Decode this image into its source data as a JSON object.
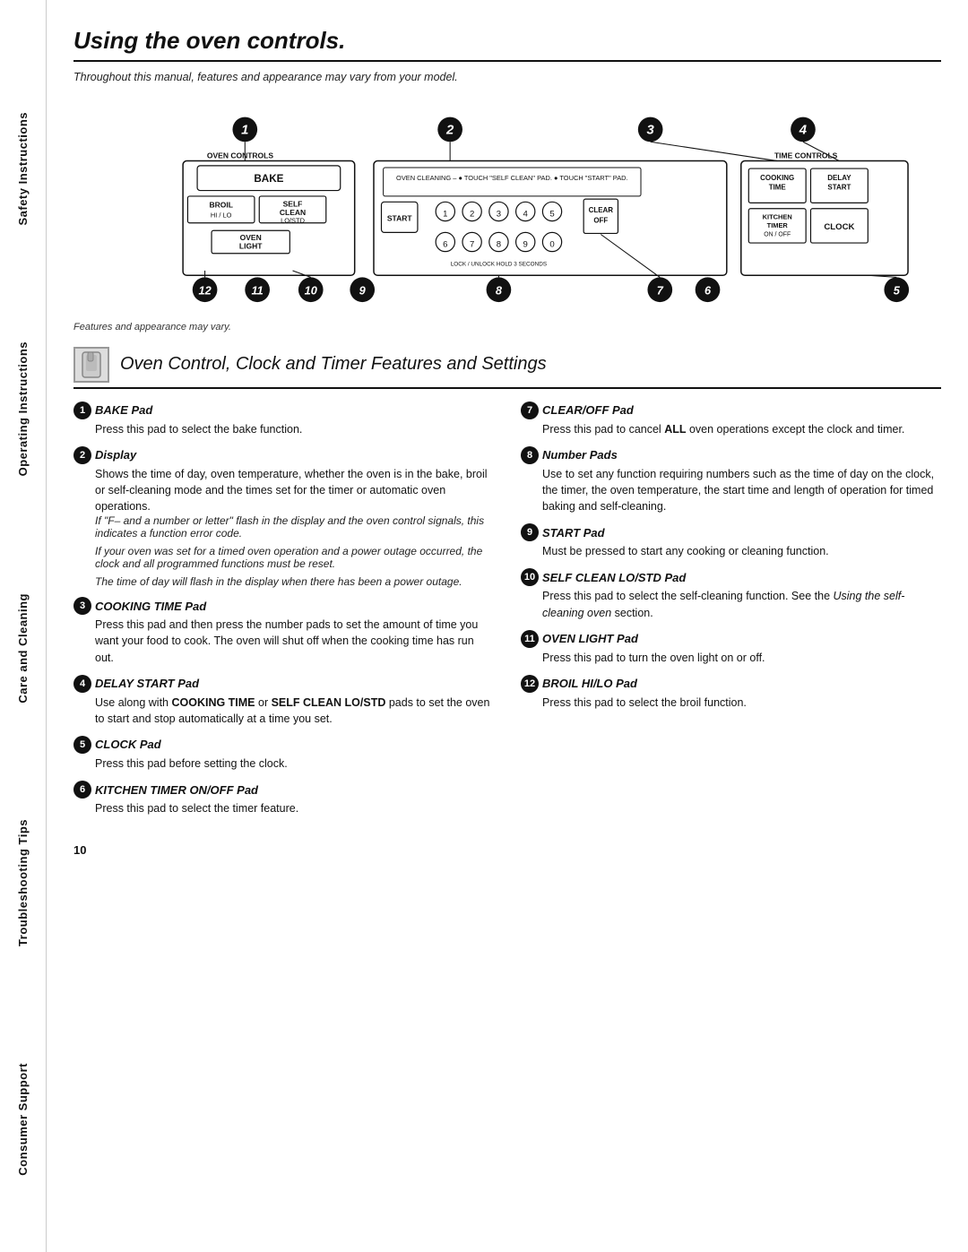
{
  "sidebar": {
    "items": [
      {
        "label": "Safety Instructions"
      },
      {
        "label": "Operating Instructions"
      },
      {
        "label": "Care and Cleaning"
      },
      {
        "label": "Troubleshooting Tips"
      },
      {
        "label": "Consumer Support"
      }
    ]
  },
  "page": {
    "title": "Using the oven controls.",
    "subtitle": "Throughout this manual, features and appearance may vary from your model.",
    "diagram_caption": "Features and appearance may vary.",
    "section_title": "Oven Control, Clock and Timer Features and Settings",
    "page_number": "10"
  },
  "features_left": [
    {
      "num": "1",
      "title": "BAKE Pad",
      "body": "Press this pad to select the bake function."
    },
    {
      "num": "2",
      "title": "Display",
      "body": "Shows the time of day, oven temperature, whether the oven is in the bake, broil or self-cleaning mode and the times set for the timer or automatic oven operations.",
      "notes": [
        "If \"F– and a number or letter\" flash in the display and the oven control signals, this indicates a function error code.",
        "If your oven was set for a timed oven operation and a power outage occurred, the clock and all programmed functions must be reset.",
        "The time of day will flash in the display when there has been a power outage."
      ]
    },
    {
      "num": "3",
      "title": "COOKING TIME Pad",
      "body": "Press this pad and then press the number pads to set the amount of time you want your food to cook. The oven will shut off when the cooking time has run out."
    },
    {
      "num": "4",
      "title": "DELAY START Pad",
      "body": "Use along with COOKING TIME or SELF CLEAN LO/STD pads to set the oven to start and stop automatically at a time you set.",
      "bold_parts": [
        "COOKING TIME",
        "SELF CLEAN LO/STD"
      ]
    },
    {
      "num": "5",
      "title": "CLOCK Pad",
      "body": "Press this pad before setting the clock."
    },
    {
      "num": "6",
      "title": "KITCHEN TIMER ON/OFF Pad",
      "body": "Press this pad to select the timer feature."
    }
  ],
  "features_right": [
    {
      "num": "7",
      "title": "CLEAR/OFF Pad",
      "body": "Press this pad to cancel ALL oven operations except the clock and timer.",
      "bold_parts": [
        "ALL"
      ]
    },
    {
      "num": "8",
      "title": "Number Pads",
      "body": "Use to set any function requiring numbers such as the time of day on the clock, the timer, the oven temperature, the start time and length of operation for timed baking and self-cleaning."
    },
    {
      "num": "9",
      "title": "START Pad",
      "body": "Must be pressed to start any cooking or cleaning function."
    },
    {
      "num": "10",
      "title": "SELF CLEAN LO/STD Pad",
      "body": "Press this pad to select the self-cleaning function. See the Using the self-cleaning oven section.",
      "italic_parts": [
        "Using the self-cleaning oven"
      ]
    },
    {
      "num": "11",
      "title": "OVEN LIGHT Pad",
      "body": "Press this pad to turn the oven light on or off."
    },
    {
      "num": "12",
      "title": "BROIL HI/LO Pad",
      "body": "Press this pad to select the broil function."
    }
  ]
}
